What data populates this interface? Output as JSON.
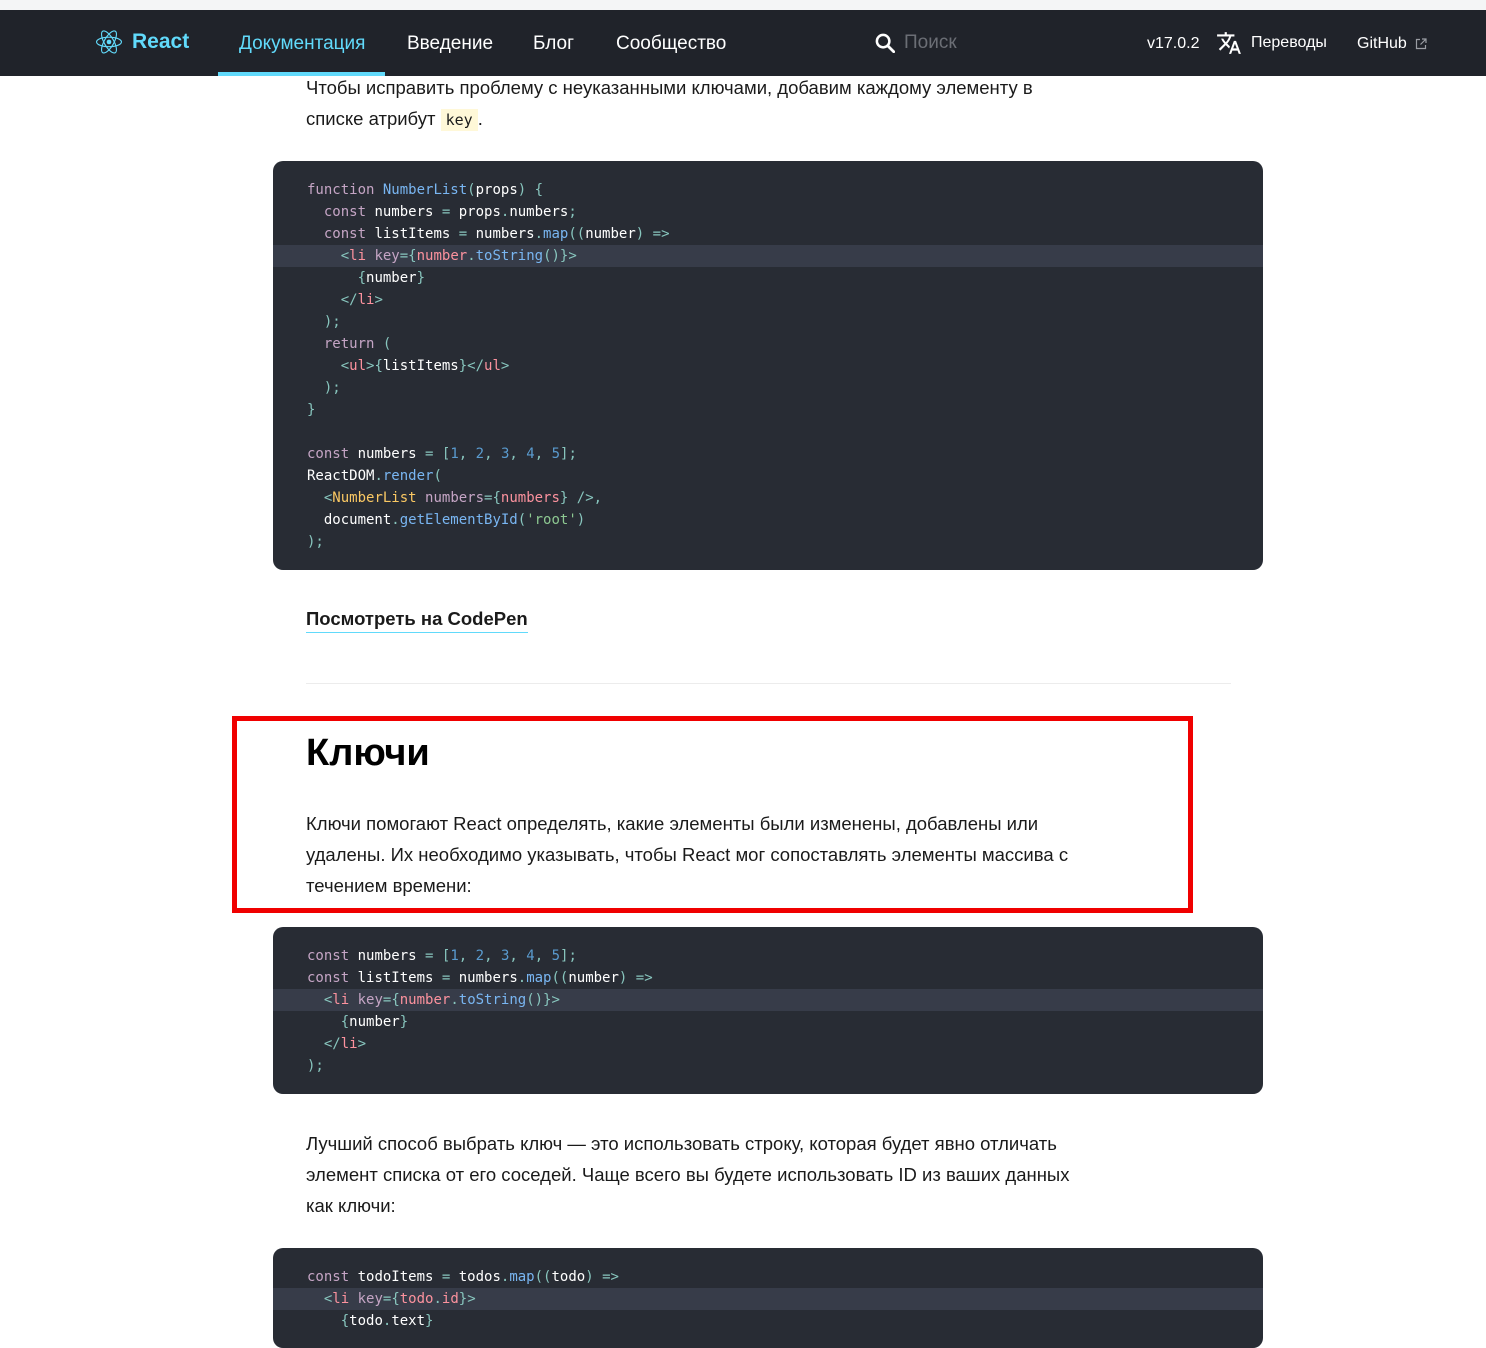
{
  "navbar": {
    "logo_text": "React",
    "links": [
      "Документация",
      "Введение",
      "Блог",
      "Сообщество"
    ],
    "search_placeholder": "Поиск",
    "version": "v17.0.2",
    "translations_label": "Переводы",
    "github_label": "GitHub"
  },
  "colors": {
    "navbar_bg": "#20232a",
    "accent": "#61dafb",
    "code_bg": "#282c34",
    "highlight_border": "#f00000"
  },
  "icons": {
    "logo": "react-atom-icon",
    "search": "search-icon",
    "translate": "translate-icon",
    "external": "external-link-icon"
  },
  "content": {
    "intro": {
      "text_before": "Чтобы исправить проблему с неуказанными ключами, добавим каждому элементу в списке атрибут",
      "code": "key",
      "text_after": "."
    },
    "code_block_1": [
      "function NumberList(props) {",
      "  const numbers = props.numbers;",
      "  const listItems = numbers.map((number) =>",
      "    <li key={number.toString()}>",
      "      {number}",
      "    </li>",
      "  );",
      "  return (",
      "    <ul>{listItems}</ul>",
      "  );",
      "}",
      "",
      "const numbers = [1, 2, 3, 4, 5];",
      "ReactDOM.render(",
      "  <NumberList numbers={numbers} />,",
      "  document.getElementById('root')",
      ");"
    ],
    "codepen_link": "Посмотреть на CodePen",
    "section_heading": "Ключи",
    "section_paragraph": "Ключи помогают React определять, какие элементы были изменены, добавлены или удалены. Их необходимо указывать, чтобы React мог сопоставлять элементы массива с течением времени:",
    "code_block_2": [
      "const numbers = [1, 2, 3, 4, 5];",
      "const listItems = numbers.map((number) =>",
      "  <li key={number.toString()}>",
      "    {number}",
      "  </li>",
      ");"
    ],
    "paragraph_2": "Лучший способ выбрать ключ — это использовать строку, которая будет явно отличать элемент списка от его соседей. Чаще всего вы будете использовать ID из ваших данных как ключи:",
    "code_block_3": [
      "const todoItems = todos.map((todo) =>",
      "  <li key={todo.id}>",
      "    {todo.text}"
    ]
  }
}
